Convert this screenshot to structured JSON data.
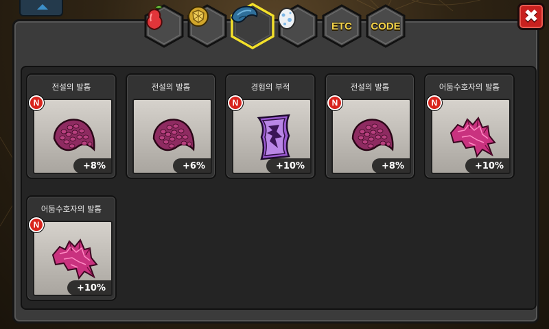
{
  "window": {
    "close_icon": "close-x-icon",
    "close_glyph": "✖"
  },
  "tabs": [
    {
      "id": "fruit",
      "icon": "red-pear-icon",
      "label": "",
      "selected": false
    },
    {
      "id": "stone",
      "icon": "gold-stone-icon",
      "label": "",
      "selected": false
    },
    {
      "id": "scale",
      "icon": "blue-claw-icon",
      "label": "",
      "selected": true
    },
    {
      "id": "egg",
      "icon": "egg-icon",
      "label": "",
      "selected": false
    },
    {
      "id": "etc",
      "icon": "",
      "label": "ETC",
      "selected": false
    },
    {
      "id": "code",
      "icon": "",
      "label": "CODE",
      "selected": false
    }
  ],
  "items": [
    {
      "name": "전설의 발톱",
      "badge": "N",
      "bonus": "+8%",
      "icon": "purple-claw-icon"
    },
    {
      "name": "전설의 발톱",
      "badge": "",
      "bonus": "+6%",
      "icon": "purple-claw-icon"
    },
    {
      "name": "경험의 부적",
      "badge": "N",
      "bonus": "+10%",
      "icon": "purple-talisman-icon"
    },
    {
      "name": "전설의 발톱",
      "badge": "N",
      "bonus": "+8%",
      "icon": "purple-claw-icon"
    },
    {
      "name": "어둠수호자의 발톱",
      "badge": "N",
      "bonus": "+10%",
      "icon": "pink-crystal-claw-icon"
    },
    {
      "name": "어둠수호자의 발톱",
      "badge": "N",
      "bonus": "+10%",
      "icon": "pink-crystal-claw-icon"
    }
  ],
  "colors": {
    "badge_red": "#d8241d",
    "tab_selected_border": "#f3e02a",
    "tab_text": "#f3d247",
    "close_red": "#c9211f"
  }
}
